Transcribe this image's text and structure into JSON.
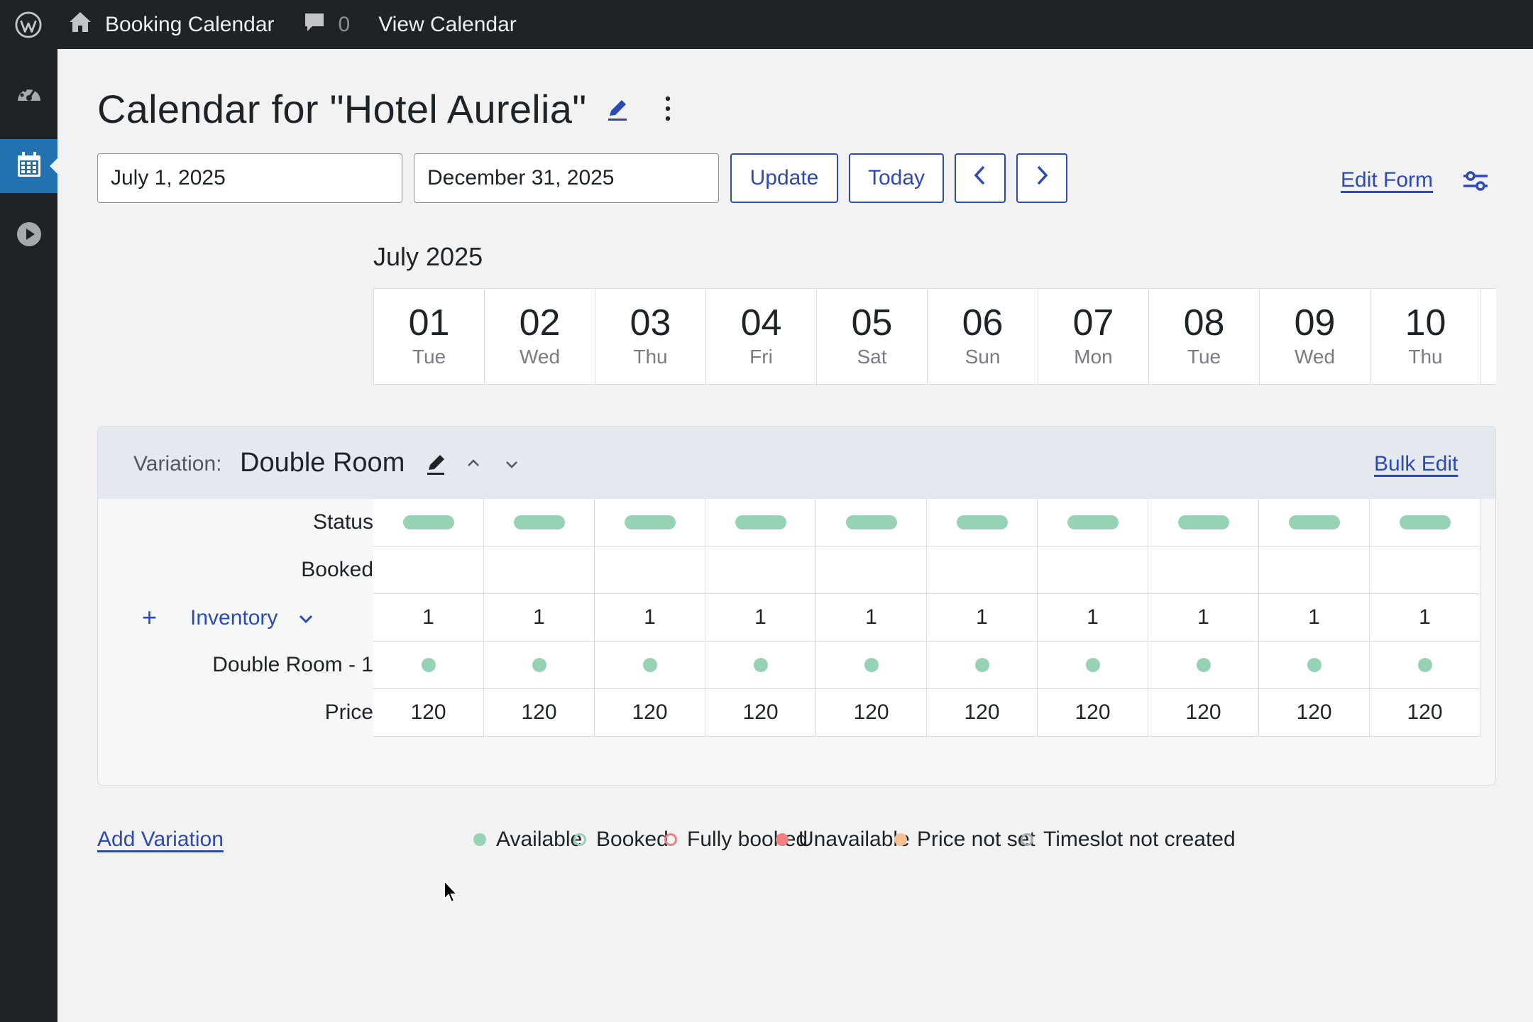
{
  "adminbar": {
    "wp_icon": "wordpress-logo-icon",
    "site_icon": "home-icon",
    "site_name": "Booking Calendar",
    "comments_icon": "comment-bubble-icon",
    "comments_count": "0",
    "view_link": "View Calendar"
  },
  "sidebar": {
    "items": [
      {
        "icon": "dashboard-icon",
        "active": false
      },
      {
        "icon": "calendar-icon",
        "active": true
      },
      {
        "icon": "play-icon",
        "active": false
      }
    ]
  },
  "page": {
    "title": "Calendar for \"Hotel Aurelia\"",
    "title_edit_icon": "pencil-icon",
    "more_icon": "vertical-ellipsis-icon"
  },
  "toolbar": {
    "start_date": "July 1, 2025",
    "end_date": "December 31, 2025",
    "update_label": "Update",
    "today_label": "Today",
    "prev_icon": "chevron-left-icon",
    "next_icon": "chevron-right-icon",
    "edit_form_label": "Edit Form",
    "settings_icon": "sliders-icon"
  },
  "calendar": {
    "month": "July 2025",
    "days": [
      {
        "num": "01",
        "name": "Tue"
      },
      {
        "num": "02",
        "name": "Wed"
      },
      {
        "num": "03",
        "name": "Thu"
      },
      {
        "num": "04",
        "name": "Fri"
      },
      {
        "num": "05",
        "name": "Sat"
      },
      {
        "num": "06",
        "name": "Sun"
      },
      {
        "num": "07",
        "name": "Mon"
      },
      {
        "num": "08",
        "name": "Tue"
      },
      {
        "num": "09",
        "name": "Wed"
      },
      {
        "num": "10",
        "name": "Thu"
      }
    ]
  },
  "variation": {
    "label": "Variation:",
    "name": "Double Room",
    "bulk_edit_label": "Bulk Edit",
    "rows": {
      "status": "Status",
      "booked": "Booked",
      "inventory": "Inventory",
      "inventory_plus": "+",
      "unit": "Double Room - 1",
      "price": "Price"
    },
    "inventory_values": [
      "1",
      "1",
      "1",
      "1",
      "1",
      "1",
      "1",
      "1",
      "1",
      "1"
    ],
    "price_values": [
      "120",
      "120",
      "120",
      "120",
      "120",
      "120",
      "120",
      "120",
      "120",
      "120"
    ],
    "status_color": "#95d3b4"
  },
  "footer": {
    "add_variation": "Add Variation",
    "legend": [
      {
        "label": "Available",
        "color": "#95d3b4",
        "style": "filled"
      },
      {
        "label": "Booked",
        "color": "#95d3b4",
        "style": "ring"
      },
      {
        "label": "Fully booked",
        "color": "#f08080",
        "style": "ring"
      },
      {
        "label": "Unavailable",
        "color": "#f08080",
        "style": "filled"
      },
      {
        "label": "Price not set",
        "color": "#f5c192",
        "style": "filled"
      },
      {
        "label": "Timeslot not created",
        "color": "#a7aaad",
        "style": "ring"
      }
    ]
  },
  "colors": {
    "accent": "#2c4ab5",
    "admin_bg": "#1d2327",
    "active_menu": "#2271b1"
  }
}
